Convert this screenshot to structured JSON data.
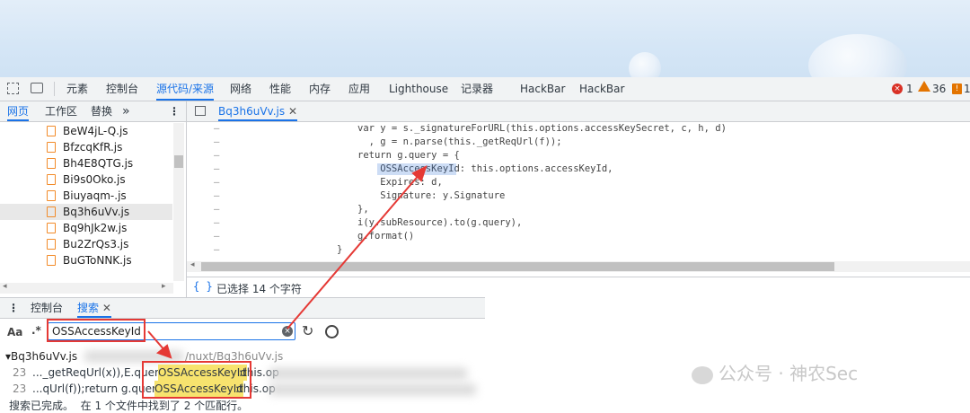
{
  "toolbar": {
    "tabs": [
      "元素",
      "控制台",
      "源代码/来源",
      "网络",
      "性能",
      "内存",
      "应用",
      "Lighthouse",
      "记录器",
      "HackBar",
      "HackBar"
    ],
    "errors": "1",
    "warnings": "36",
    "info": "1"
  },
  "navigator": {
    "tabs": [
      "网页",
      "工作区",
      "替换"
    ],
    "more": "»",
    "files": [
      "BeW4jL-Q.js",
      "BfzcqKfR.js",
      "Bh4E8QTG.js",
      "Bi9s0Oko.js",
      "Biuyaqm-.js",
      "Bq3h6uVv.js",
      "Bq9hJk2w.js",
      "Bu2ZrQs3.js",
      "BuGToNNK.js"
    ],
    "selected": "Bq3h6uVv.js"
  },
  "editor": {
    "open_file": "Bq3h6uVv.js",
    "lines": [
      {
        "text": "var y = s._signatureForURL(this.options.accessKeySecret, c, h, d)"
      },
      {
        "text": "  , g = n.parse(this._getReqUrl(f));"
      },
      {
        "text": "return g.query = {"
      },
      {
        "text": "    OSSAccessKeyId: this.options.accessKeyId,"
      },
      {
        "text": "    Expires: d,"
      },
      {
        "text": "    Signature: y.Signature"
      },
      {
        "text": "},"
      },
      {
        "text": "i(y.subResource).to(g.query),"
      },
      {
        "text": "g.format()"
      },
      {
        "text": "}"
      }
    ],
    "gutter": "–",
    "status": "已选择 14 个字符"
  },
  "drawer": {
    "tabs": [
      "控制台",
      "搜索"
    ],
    "search_value": "OSSAccessKeyId",
    "case_label": "Aa",
    "regex_label": ".*",
    "result_file": "▾Bq3h6uVv.js",
    "result_path": "/nuxt/Bq3h6uVv.js",
    "results": [
      {
        "line": "23",
        "before": "..._getReqUrl(x)),E.query={",
        "match": "OSSAccessKeyId",
        "after": ":this.op"
      },
      {
        "line": "23",
        "before": "...qUrl(f));return g.query={",
        "match": "OSSAccessKeyId",
        "after": ":this.op"
      }
    ],
    "summary": "搜索已完成。  在 1 个文件中找到了 2 个匹配行。"
  },
  "watermark": "公众号 · 神农Sec"
}
